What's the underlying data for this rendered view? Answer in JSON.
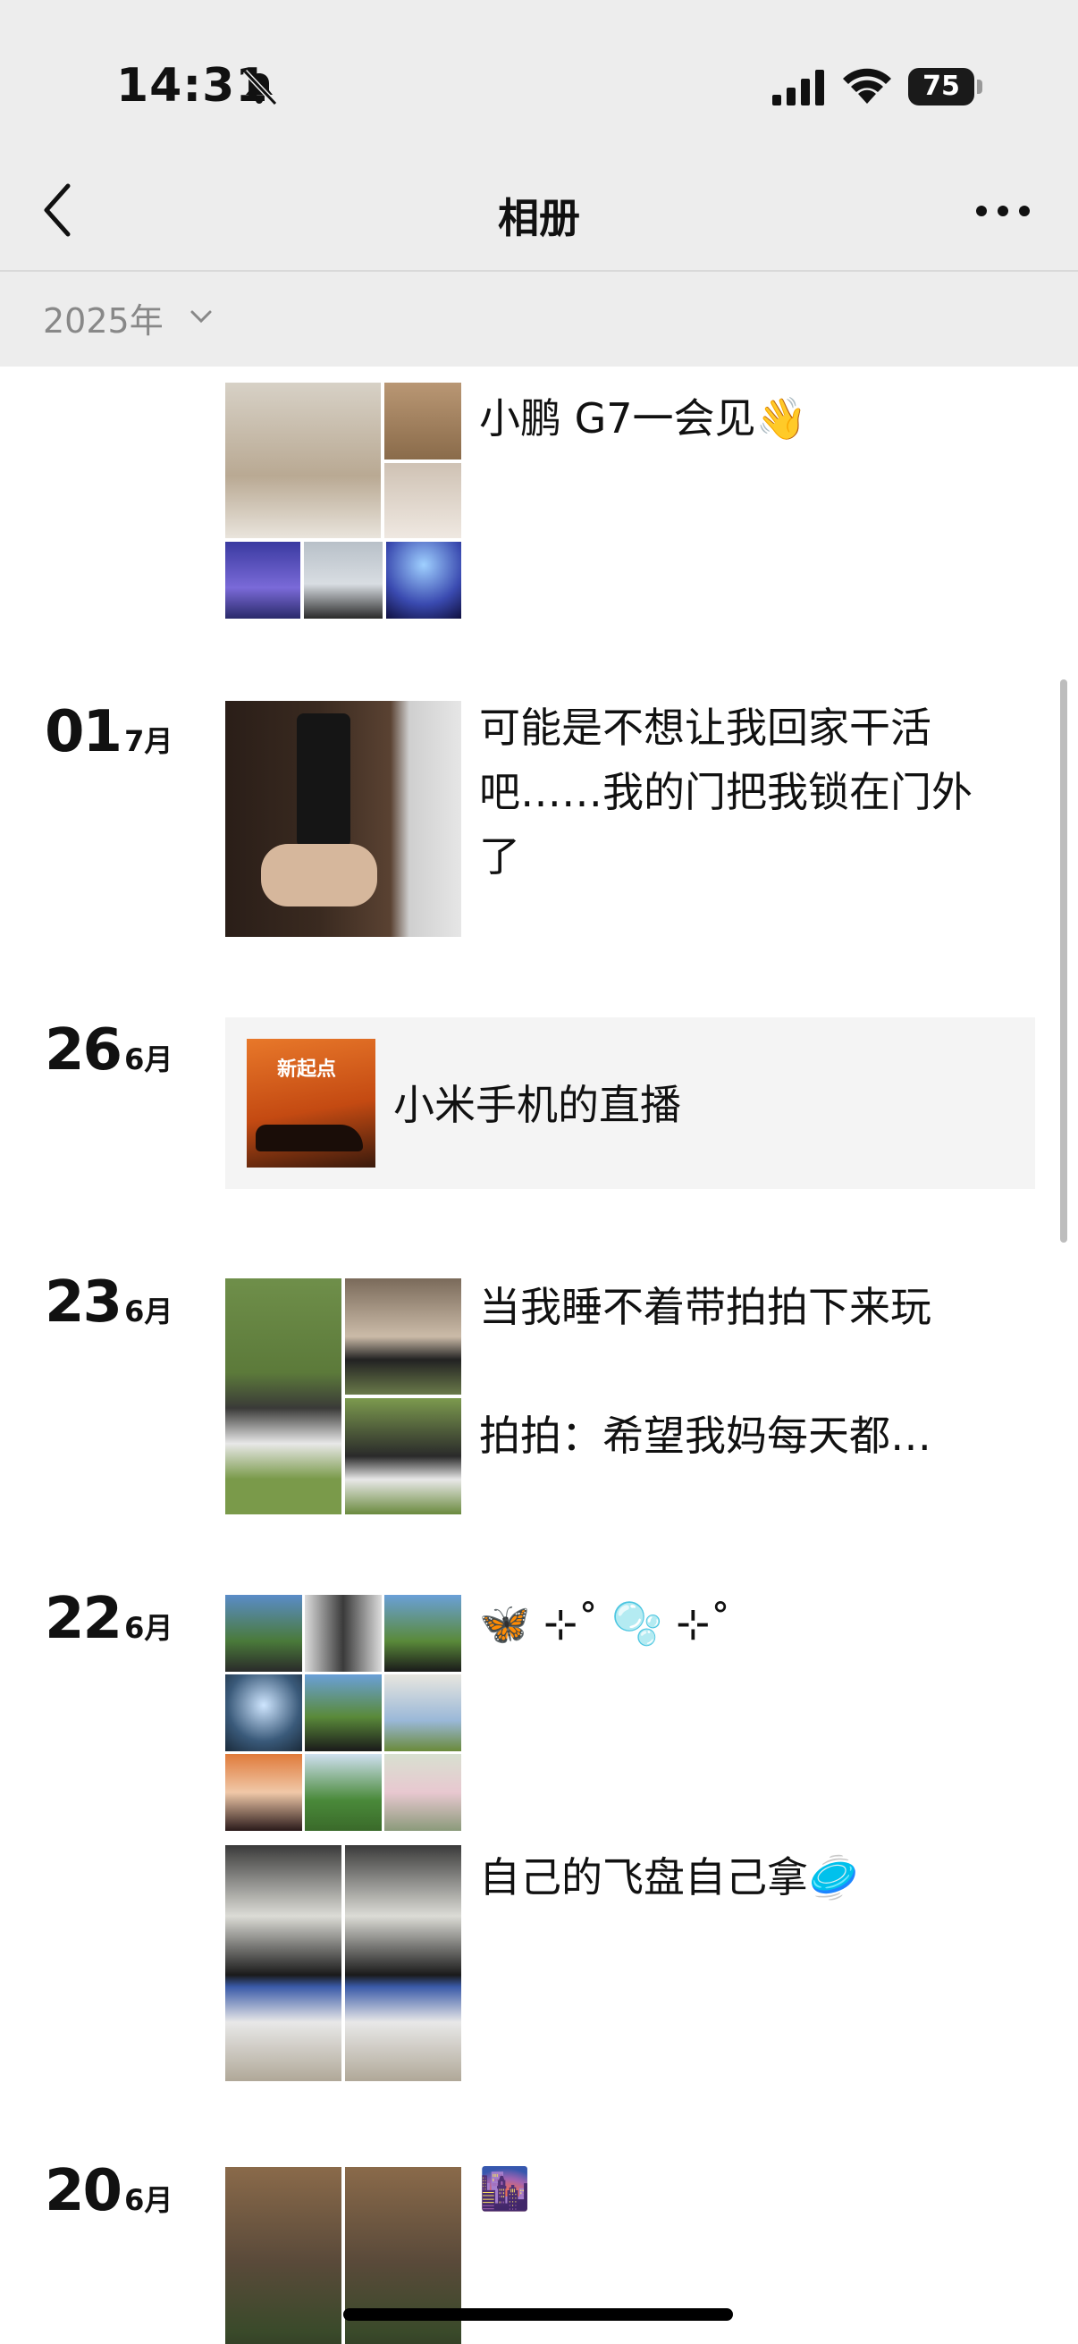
{
  "status_bar": {
    "time": "14:31",
    "battery": "75"
  },
  "nav": {
    "title": "相册"
  },
  "year_filter": {
    "label": "2025年"
  },
  "entries": [
    {
      "day": "",
      "month": "",
      "caption": "小鹏 G7一会见👋"
    },
    {
      "day": "01",
      "month": "7月",
      "caption": "可能是不想让我回家干活吧……我的门把我锁在门外了"
    },
    {
      "day": "26",
      "month": "6月",
      "caption": "小米手机的直播",
      "share_thumb_text": "新起点"
    },
    {
      "day": "23",
      "month": "6月",
      "caption": "当我睡不着带拍拍下来玩\n\n拍拍：希望我妈每天都…"
    },
    {
      "day": "22",
      "month": "6月",
      "caption": "🦋 ⊹˚ 🫧 ⊹˚",
      "caption2": "自己的飞盘自己拿🥏"
    },
    {
      "day": "20",
      "month": "6月",
      "caption": "🌆"
    }
  ],
  "colors": {
    "header_bg": "#ededed",
    "muted_text": "#888888",
    "share_bg": "#f4f4f4"
  }
}
